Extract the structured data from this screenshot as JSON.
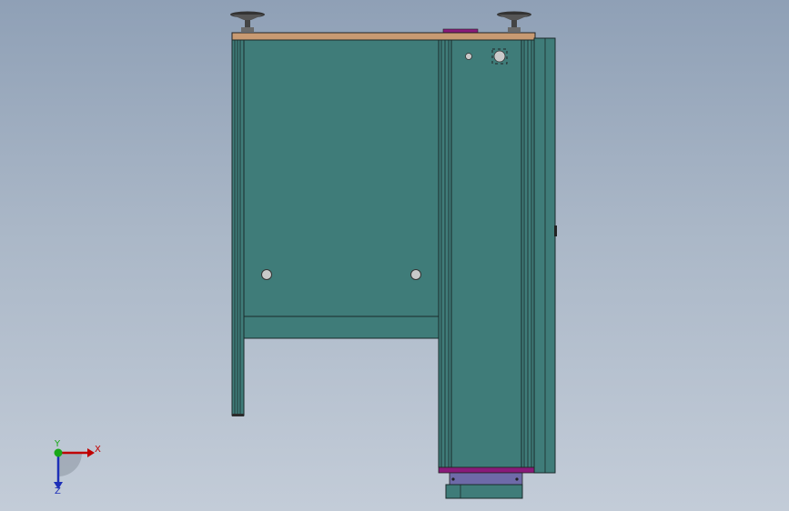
{
  "viewport": {
    "background_top": "#8fa0b6",
    "background_bottom": "#c3ccd8"
  },
  "model": {
    "panel_color": "#3f7c79",
    "top_plate_color": "#c89a72",
    "accent_color": "#8a1a7a",
    "bracket_color": "#6e6aa8",
    "feet": [
      "leveling-foot",
      "leveling-foot"
    ]
  },
  "triad": {
    "x_label": "X",
    "y_label": "Y",
    "z_label": "Z"
  }
}
